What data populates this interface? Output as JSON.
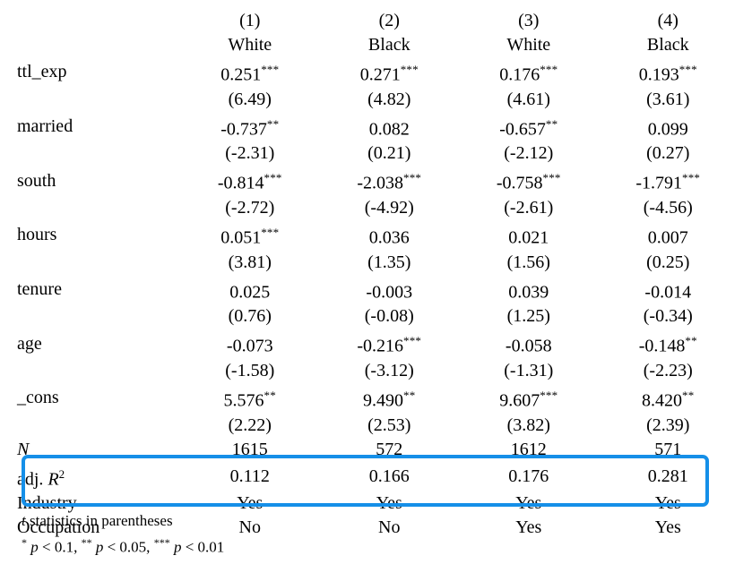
{
  "table": {
    "header": {
      "numbers": [
        "",
        "(1)",
        "(2)",
        "(3)",
        "(4)"
      ],
      "groups": [
        "",
        "White",
        "Black",
        "White",
        "Black"
      ]
    },
    "coefficient_rows": [
      {
        "label": "ttl_exp",
        "coefs": [
          "0.251",
          "0.271",
          "0.176",
          "0.193"
        ],
        "stars": [
          "***",
          "***",
          "***",
          "***"
        ],
        "tstats": [
          "(6.49)",
          "(4.82)",
          "(4.61)",
          "(3.61)"
        ]
      },
      {
        "label": "married",
        "coefs": [
          "-0.737",
          "0.082",
          "-0.657",
          "0.099"
        ],
        "stars": [
          "**",
          "",
          "**",
          ""
        ],
        "tstats": [
          "(-2.31)",
          "(0.21)",
          "(-2.12)",
          "(0.27)"
        ]
      },
      {
        "label": "south",
        "coefs": [
          "-0.814",
          "-2.038",
          "-0.758",
          "-1.791"
        ],
        "stars": [
          "***",
          "***",
          "***",
          "***"
        ],
        "tstats": [
          "(-2.72)",
          "(-4.92)",
          "(-2.61)",
          "(-4.56)"
        ]
      },
      {
        "label": "hours",
        "coefs": [
          "0.051",
          "0.036",
          "0.021",
          "0.007"
        ],
        "stars": [
          "***",
          "",
          "",
          ""
        ],
        "tstats": [
          "(3.81)",
          "(1.35)",
          "(1.56)",
          "(0.25)"
        ]
      },
      {
        "label": "tenure",
        "coefs": [
          "0.025",
          "-0.003",
          "0.039",
          "-0.014"
        ],
        "stars": [
          "",
          "",
          "",
          ""
        ],
        "tstats": [
          "(0.76)",
          "(-0.08)",
          "(1.25)",
          "(-0.34)"
        ]
      },
      {
        "label": "age",
        "coefs": [
          "-0.073",
          "-0.216",
          "-0.058",
          "-0.148"
        ],
        "stars": [
          "",
          "***",
          "",
          "**"
        ],
        "tstats": [
          "(-1.58)",
          "(-3.12)",
          "(-1.31)",
          "(-2.23)"
        ]
      },
      {
        "label": "_cons",
        "coefs": [
          "5.576",
          "9.490",
          "9.607",
          "8.420"
        ],
        "stars": [
          "**",
          "**",
          "***",
          "**"
        ],
        "tstats": [
          "(2.22)",
          "(2.53)",
          "(3.82)",
          "(2.39)"
        ]
      }
    ],
    "stat_rows": [
      {
        "label": "N",
        "label_italic": true,
        "values": [
          "1615",
          "572",
          "1612",
          "571"
        ]
      },
      {
        "label": "adj. R",
        "label_sup": "2",
        "label_r_italic": true,
        "values": [
          "0.112",
          "0.166",
          "0.176",
          "0.281"
        ]
      }
    ],
    "control_rows": [
      {
        "label": "Industry",
        "values": [
          "Yes",
          "Yes",
          "Yes",
          "Yes"
        ]
      },
      {
        "label": "Occupation",
        "values": [
          "No",
          "No",
          "Yes",
          "Yes"
        ]
      }
    ],
    "footnotes": {
      "line1_italic_lead": "t",
      "line1_rest": " statistics in parentheses",
      "line2_parts": [
        {
          "star": "*",
          "text": " p < 0.1, "
        },
        {
          "star": "**",
          "text": " p < 0.05, "
        },
        {
          "star": "***",
          "text": " p < 0.01"
        }
      ]
    },
    "highlight": {
      "color": "#158FE8",
      "covers": [
        "Industry",
        "Occupation"
      ]
    }
  }
}
